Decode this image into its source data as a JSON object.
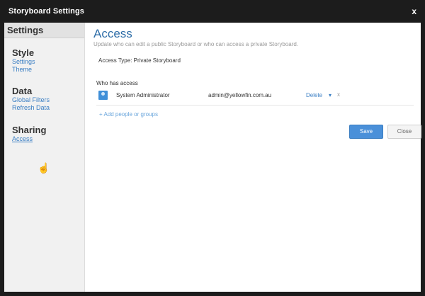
{
  "window": {
    "title": "Storyboard Settings",
    "close_label": "x"
  },
  "sidebar": {
    "header": "Settings",
    "groups": [
      {
        "title": "Style",
        "items": [
          {
            "label": "Settings"
          },
          {
            "label": "Theme"
          }
        ]
      },
      {
        "title": "Data",
        "items": [
          {
            "label": "Global Filters"
          },
          {
            "label": "Refresh Data"
          }
        ]
      },
      {
        "title": "Sharing",
        "items": [
          {
            "label": "Access"
          }
        ]
      }
    ],
    "active_item": "Access"
  },
  "main": {
    "title": "Access",
    "subtitle": "Update who can edit a public Storyboard or who can access a private Storyboard.",
    "access_type": "Access Type: Private Storyboard",
    "who_label": "Who has access",
    "users": [
      {
        "name": "System Administrator",
        "email": "admin@yellowfin.com.au",
        "role": "Delete",
        "caret": "▾",
        "remove": "x"
      }
    ],
    "add_link": "+ Add people or groups",
    "save_label": "Save",
    "close_label": "Close"
  },
  "colors": {
    "title_bar": "#1c1c1c",
    "accent": "#2f6ea8",
    "link": "#3b7fc4",
    "save_button": "#4a90d9"
  },
  "icons": {
    "user": "user-avatar-icon",
    "cursor": "hand-pointer-icon"
  }
}
